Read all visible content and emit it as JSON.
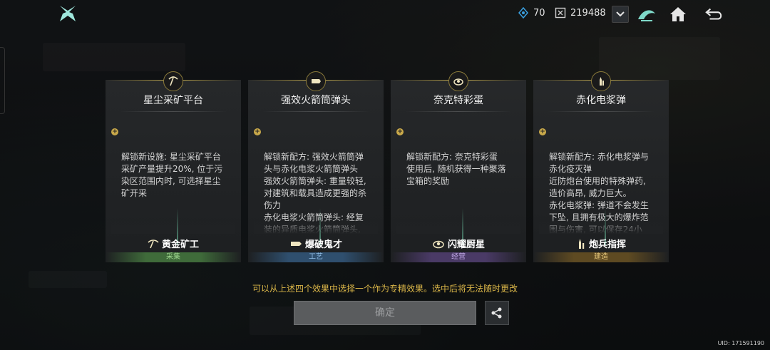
{
  "header": {
    "energy": "70",
    "currency": "219488"
  },
  "cards": [
    {
      "title": "星尘采矿平台",
      "desc": "解锁新设施: 星尘采矿平台\n采矿产量提升20%, 位于污\n染区范围内时, 可选择星尘\n矿开采",
      "talent": "黄金矿工",
      "tag": "采集",
      "tag_color": "#3f6b3a",
      "tag_text_color": "#9ed58f"
    },
    {
      "title": "强效火箭筒弹头",
      "desc": "解锁新配方: 强效火箭筒弹\n头与赤化电浆火箭筒弹头\n强效火箭筒弹头: 重量较轻,\n对建筑和载具造成更强的杀\n伤力\n赤化电浆火箭筒弹头: 经复\n装的异质电浆火箭筒弹头,\n弹头加入了赤化活银, 只需\n要轻触就能引发火焰爆炸",
      "talent": "爆破鬼才",
      "tag": "工艺",
      "tag_color": "#2f4f6e",
      "tag_text_color": "#8fbde6"
    },
    {
      "title": "奈克特彩蛋",
      "desc": "解锁新配方: 奈克特彩蛋\n使用后, 随机获得一种聚落\n宝箱的奖励",
      "talent": "闪耀厨星",
      "tag": "经营",
      "tag_color": "#4a3a66",
      "tag_text_color": "#bfa6e6"
    },
    {
      "title": "赤化电浆弹",
      "desc": "解锁新配方: 赤化电浆弹与\n赤化疫灭弹\n近防炮台使用的特殊弹药,\n造价高昂, 威力巨大。\n赤化电浆弹: 弹道不会发生\n下坠, 且拥有极大的爆炸范\n围与伤害, 可以保存24小\n时。\n赤化疫灭弹: 赤化疫灭弹专门",
      "talent": "炮兵指挥",
      "tag": "建造",
      "tag_color": "#5e4a22",
      "tag_text_color": "#e6c77a"
    }
  ],
  "hint": "可以从上述四个效果中选择一个作为专精效果。选中后将无法随时更改",
  "confirm_label": "确定",
  "uid": "UID: 171591190",
  "icons": [
    "logo-icon",
    "energy-icon",
    "currency-icon",
    "chevron-down-icon",
    "faction-icon",
    "home-icon",
    "back-icon",
    "pickaxe-icon",
    "rocket-icon",
    "egg-icon",
    "shell-icon",
    "share-icon"
  ]
}
